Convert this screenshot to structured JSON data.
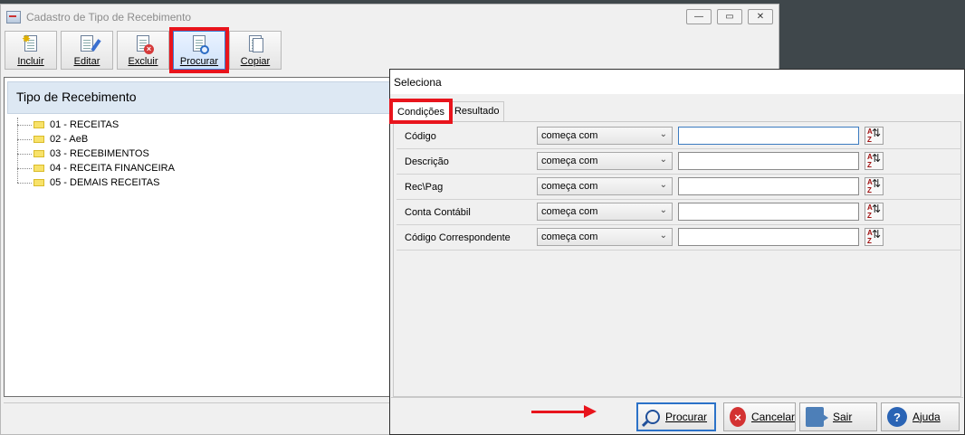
{
  "main_window": {
    "title": "Cadastro de Tipo de Recebimento",
    "window_controls": {
      "minimize": "—",
      "restore": "▭",
      "close": "✕"
    },
    "toolbar": [
      {
        "label": "Incluir",
        "icon": "new-document-icon"
      },
      {
        "label": "Editar",
        "icon": "edit-document-icon"
      },
      {
        "label": "Excluir",
        "icon": "delete-document-icon"
      },
      {
        "label": "Procurar",
        "icon": "search-document-icon",
        "highlighted": true
      },
      {
        "label": "Copiar",
        "icon": "copy-document-icon"
      }
    ],
    "panel_title": "Tipo de Recebimento",
    "tree_items": [
      "01 - RECEITAS",
      "02 - AeB",
      "03 - RECEBIMENTOS",
      "04 - RECEITA FINANCEIRA",
      "05 - DEMAIS RECEITAS"
    ]
  },
  "dialog": {
    "title": "Seleciona",
    "tabs": [
      {
        "label": "Condições",
        "active": true
      },
      {
        "label": "Resultado",
        "active": false
      }
    ],
    "conditions": [
      {
        "label": "Código",
        "operator": "começa com",
        "value": ""
      },
      {
        "label": "Descrição",
        "operator": "começa com",
        "value": ""
      },
      {
        "label": "Rec\\Pag",
        "operator": "começa com",
        "value": ""
      },
      {
        "label": "Conta Contábil",
        "operator": "começa com",
        "value": ""
      },
      {
        "label": "Código Correspondente",
        "operator": "começa com",
        "value": ""
      }
    ],
    "sort_button": {
      "top": "A",
      "bottom": "Z"
    },
    "buttons": {
      "search": "Procurar",
      "cancel": "Cancelar",
      "exit": "Sair",
      "help": "Ajuda"
    }
  },
  "colors": {
    "highlight": "#e8141c",
    "panel_header": "#dde8f3",
    "primary_border": "#2b72c8"
  }
}
